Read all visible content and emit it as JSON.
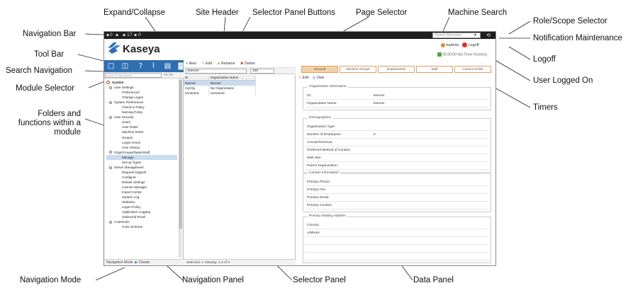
{
  "callouts": {
    "expand_collapse": "Expand/Collapse",
    "site_header": "Site Header",
    "selector_panel_buttons": "Selector Panel Buttons",
    "page_selector": "Page Selector",
    "machine_search": "Machine Search",
    "role_scope_selector": "Role/Scope Selector",
    "navigation_bar": "Navigation Bar",
    "notification_maintenance": "Notification Maintenance",
    "tool_bar": "Tool Bar",
    "logoff": "Logoff",
    "search_navigation": "Search Navigation",
    "user_logged_on": "User Logged On",
    "module_selector": "Module Selector",
    "timers": "Timers",
    "folders_functions": "Folders and functions within a module",
    "navigation_mode": "Navigation Mode",
    "navigation_panel": "Navigation Panel",
    "selector_panel": "Selector Panel",
    "data_panel": "Data Panel"
  },
  "app": {
    "logo": "Kaseya",
    "topbar_counts": [
      "0",
      "17",
      "0"
    ],
    "machine_search_placeholder": "Search Machines",
    "user": {
      "name": "kadmin",
      "logoff": "Logoff"
    },
    "timers_text": "00:00:00",
    "timers_status": "Not Timer Running",
    "search_nav_placeholder": "Search Navigation",
    "search_nav_buttons": "<< >>",
    "nav_mode": {
      "label": "Navigation Mode",
      "value": "Classic"
    },
    "tree": [
      {
        "label": "System",
        "level": 0
      },
      {
        "label": "User Settings",
        "level": 1
      },
      {
        "label": "Preferences",
        "level": 2
      },
      {
        "label": "Change Logon",
        "level": 2
      },
      {
        "label": "System Preferences",
        "level": 1
      },
      {
        "label": "Check-in Policy",
        "level": 2
      },
      {
        "label": "Naming Policy",
        "level": 2
      },
      {
        "label": "User Security",
        "level": 1
      },
      {
        "label": "Users",
        "level": 2
      },
      {
        "label": "User Roles",
        "level": 2
      },
      {
        "label": "Machine Roles",
        "level": 2
      },
      {
        "label": "Scopes",
        "level": 2
      },
      {
        "label": "Logon Hours",
        "level": 2
      },
      {
        "label": "User History",
        "level": 2
      },
      {
        "label": "Orgs/Groups/Depts/Staff",
        "level": 1
      },
      {
        "label": "Manage",
        "level": 2,
        "selected": true
      },
      {
        "label": "Set-up Types",
        "level": 2
      },
      {
        "label": "Server Management",
        "level": 1
      },
      {
        "label": "Request Support",
        "level": 2
      },
      {
        "label": "Configure",
        "level": 2
      },
      {
        "label": "Default Settings",
        "level": 2
      },
      {
        "label": "License Manager",
        "level": 2
      },
      {
        "label": "Import Center",
        "level": 2
      },
      {
        "label": "System Log",
        "level": 2
      },
      {
        "label": "Statistics",
        "level": 2
      },
      {
        "label": "Logon Policy",
        "level": 2
      },
      {
        "label": "Application Logging",
        "level": 2
      },
      {
        "label": "Outbound Email",
        "level": 2
      },
      {
        "label": "Customize",
        "level": 1
      },
      {
        "label": "Color Scheme",
        "level": 2
      }
    ],
    "selector": {
      "buttons": {
        "new": "New",
        "edit": "Edit",
        "rename": "Rename",
        "delete": "Delete"
      },
      "filter_value": "kserver",
      "page_size": "100",
      "columns": [
        "ID",
        "Organization Name"
      ],
      "rows": [
        {
          "id": "kserver",
          "name": "kserver",
          "selected": true
        },
        {
          "id": "myOrg",
          "name": "My Organization"
        },
        {
          "id": "unnamed",
          "name": "Unnamed"
        }
      ],
      "footer": "Selected: 1   Viewing: 1-3 of 3"
    },
    "data": {
      "tabs": [
        "General",
        "Machine Groups",
        "Departments",
        "Staff",
        "Custom Fields"
      ],
      "toolbar": {
        "edit": "Edit",
        "view": "View"
      },
      "sections": {
        "org_info": {
          "title": "Organization Information",
          "rows": [
            {
              "label": "ID:",
              "value": "kserver"
            },
            {
              "label": "Organization Name:",
              "value": "kserver"
            }
          ]
        },
        "demographics": {
          "title": "Demographics",
          "rows": [
            {
              "label": "Organization Type:",
              "value": ""
            },
            {
              "label": "Number of Employees:",
              "value": "0"
            },
            {
              "label": "Annual Revenue:",
              "value": ""
            },
            {
              "label": "Preferred Method of Contact:",
              "value": ""
            },
            {
              "label": "Web Site:",
              "value": ""
            },
            {
              "label": "Parent Organization:",
              "value": ""
            }
          ]
        },
        "contact": {
          "title": "Contact Information",
          "rows": [
            {
              "label": "Primary Phone:",
              "value": ""
            },
            {
              "label": "Primary Fax:",
              "value": ""
            },
            {
              "label": "Primary Email:",
              "value": ""
            },
            {
              "label": "Primary Contact:",
              "value": ""
            }
          ]
        },
        "mailing": {
          "title": "Primary Mailing Address",
          "rows": [
            {
              "label": "Country:",
              "value": ""
            },
            {
              "label": "Address:",
              "value": ""
            },
            {
              "label": "",
              "value": ""
            },
            {
              "label": "",
              "value": ""
            },
            {
              "label": "",
              "value": ""
            }
          ]
        }
      }
    }
  }
}
